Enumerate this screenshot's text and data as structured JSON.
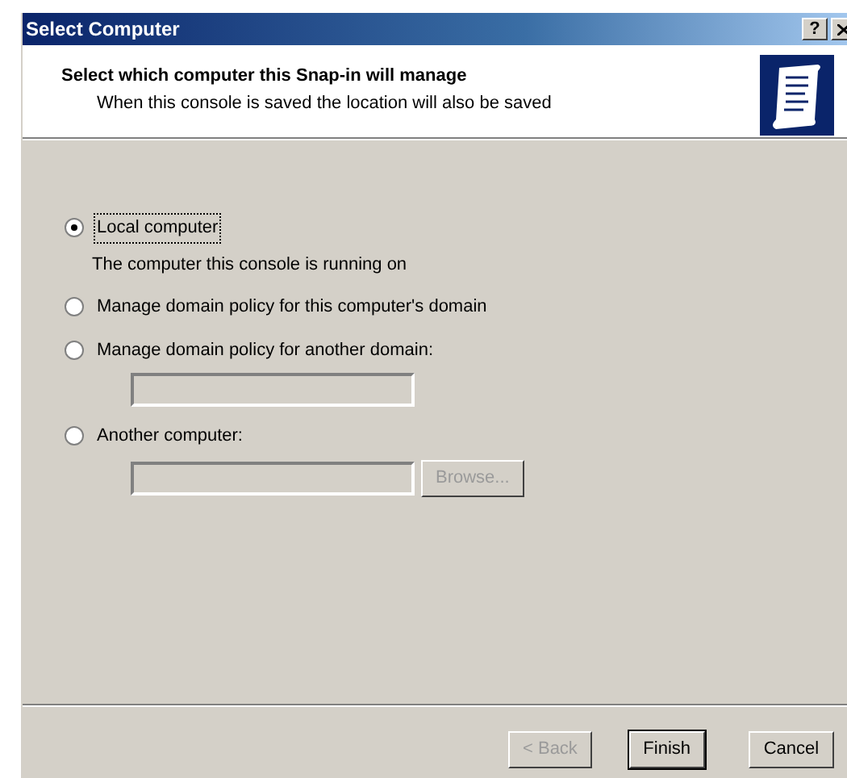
{
  "window": {
    "title": "Select Computer",
    "help_button": "?"
  },
  "header": {
    "title": "Select which computer this Snap-in will manage",
    "subtitle": "When this console is saved the location will also be saved"
  },
  "options": [
    {
      "kind": "radio",
      "label": "Local computer",
      "selected": true,
      "focused": true,
      "note": "The computer this console is running on"
    },
    {
      "kind": "radio",
      "label": "Manage domain policy for this computer's domain",
      "selected": false,
      "focused": false
    },
    {
      "kind": "radio",
      "label": "Manage domain policy for another domain:",
      "selected": false,
      "focused": false,
      "field": {
        "disabled": true
      }
    },
    {
      "kind": "radio",
      "label": "Another computer:",
      "selected": false,
      "focused": false,
      "field": {
        "disabled": true
      },
      "button": {
        "label": "Browse...",
        "disabled": true
      }
    }
  ],
  "buttons": [
    {
      "label": "< Back",
      "disabled": true,
      "default": false
    },
    {
      "label": "Finish",
      "disabled": false,
      "default": true
    },
    {
      "label": "Cancel",
      "disabled": false,
      "default": false
    }
  ]
}
